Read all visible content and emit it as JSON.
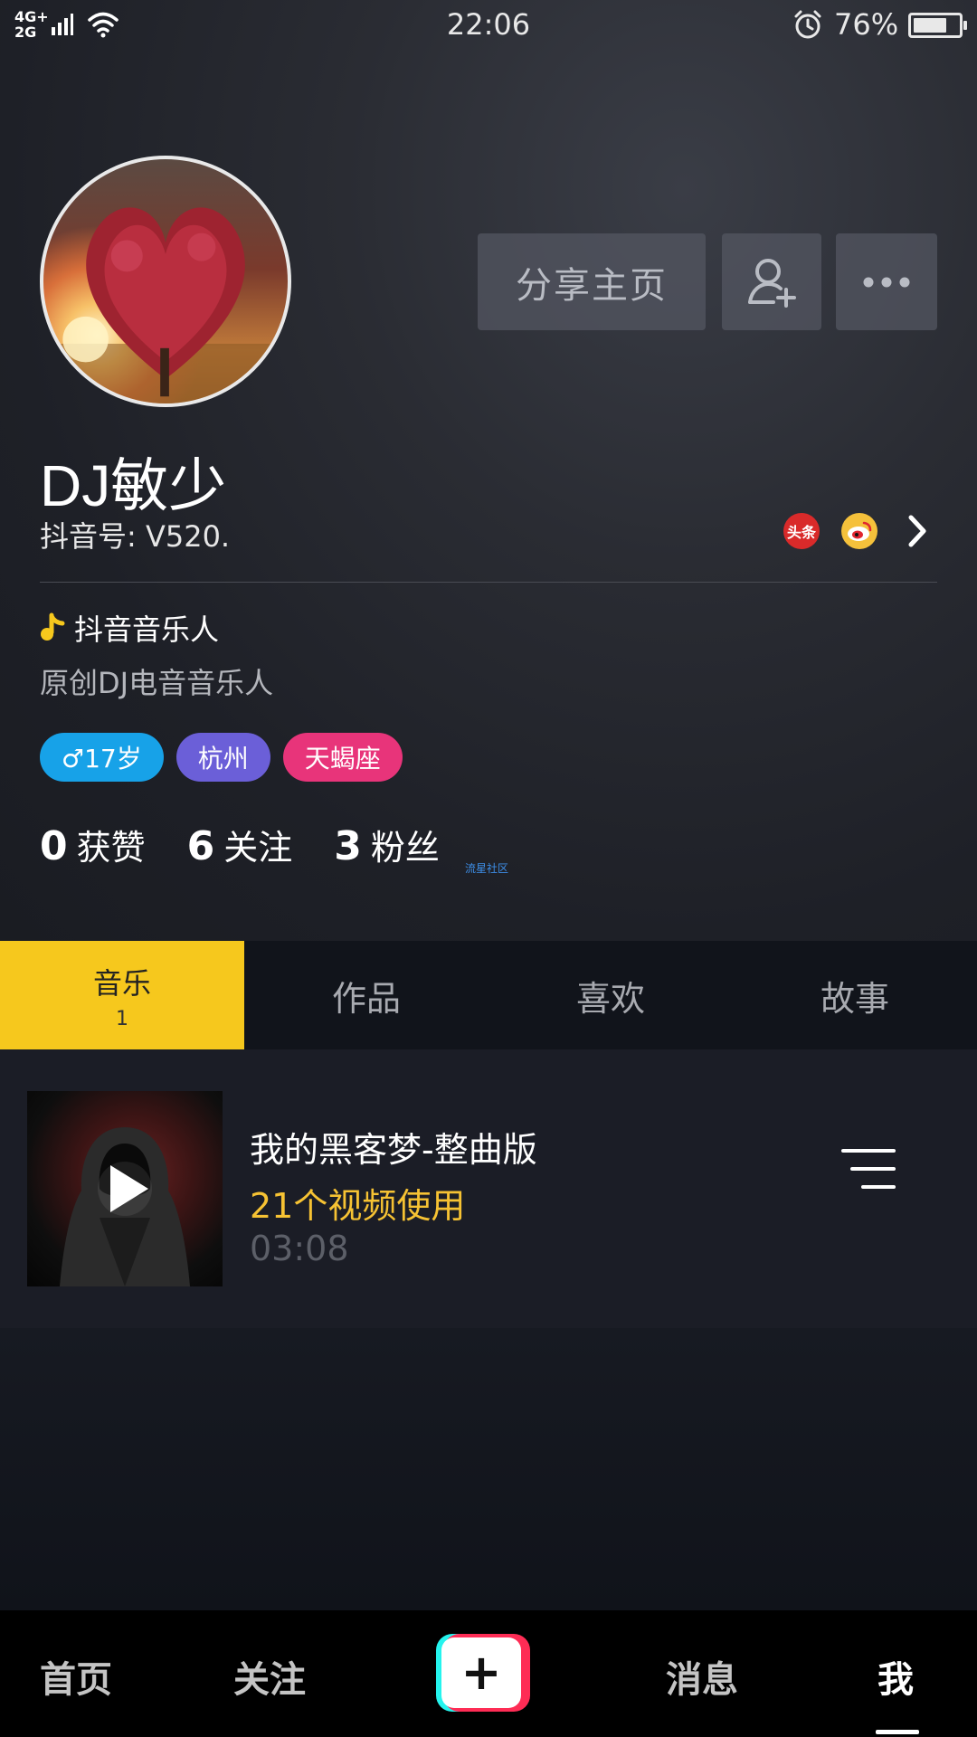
{
  "status_bar": {
    "network": "4G+\n2G",
    "time": "22:06",
    "battery_percent": "76%",
    "battery_level": 0.76
  },
  "profile": {
    "name": "DJ敏少",
    "id_label": "抖音号: V520.",
    "verified_tag": "抖音音乐人",
    "bio": "原创DJ电音音乐人",
    "tags": {
      "gender_age": "♂17岁",
      "city": "杭州",
      "zodiac": "天蝎座"
    },
    "stats": [
      {
        "num": "0",
        "label": "获赞"
      },
      {
        "num": "6",
        "label": "关注"
      },
      {
        "num": "3",
        "label": "粉丝"
      }
    ],
    "social_toutiao_text": "头条",
    "watermark": "流星社区"
  },
  "actions": {
    "share_label": "分享主页"
  },
  "tabs": [
    {
      "label": "音乐",
      "count": "1"
    },
    {
      "label": "作品"
    },
    {
      "label": "喜欢"
    },
    {
      "label": "故事"
    }
  ],
  "tracks": [
    {
      "title": "我的黑客梦-整曲版",
      "usage": "21个视频使用",
      "duration": "03:08"
    }
  ],
  "bottom_nav": {
    "home": "首页",
    "follow": "关注",
    "create": "+",
    "messages": "消息",
    "me": "我"
  },
  "colors": {
    "accent_yellow": "#f6c81d",
    "tag_gender": "#17a2e8",
    "tag_city": "#6b5fd8",
    "tag_zodiac": "#e8347a",
    "usage_text": "#f6c233"
  },
  "icons": [
    "signal-icon",
    "wifi-icon",
    "alarm-icon",
    "battery-icon",
    "add-friend-icon",
    "more-icon",
    "toutiao-icon",
    "weibo-icon",
    "chevron-right-icon",
    "music-note-icon",
    "play-icon",
    "menu-icon",
    "plus-icon"
  ]
}
